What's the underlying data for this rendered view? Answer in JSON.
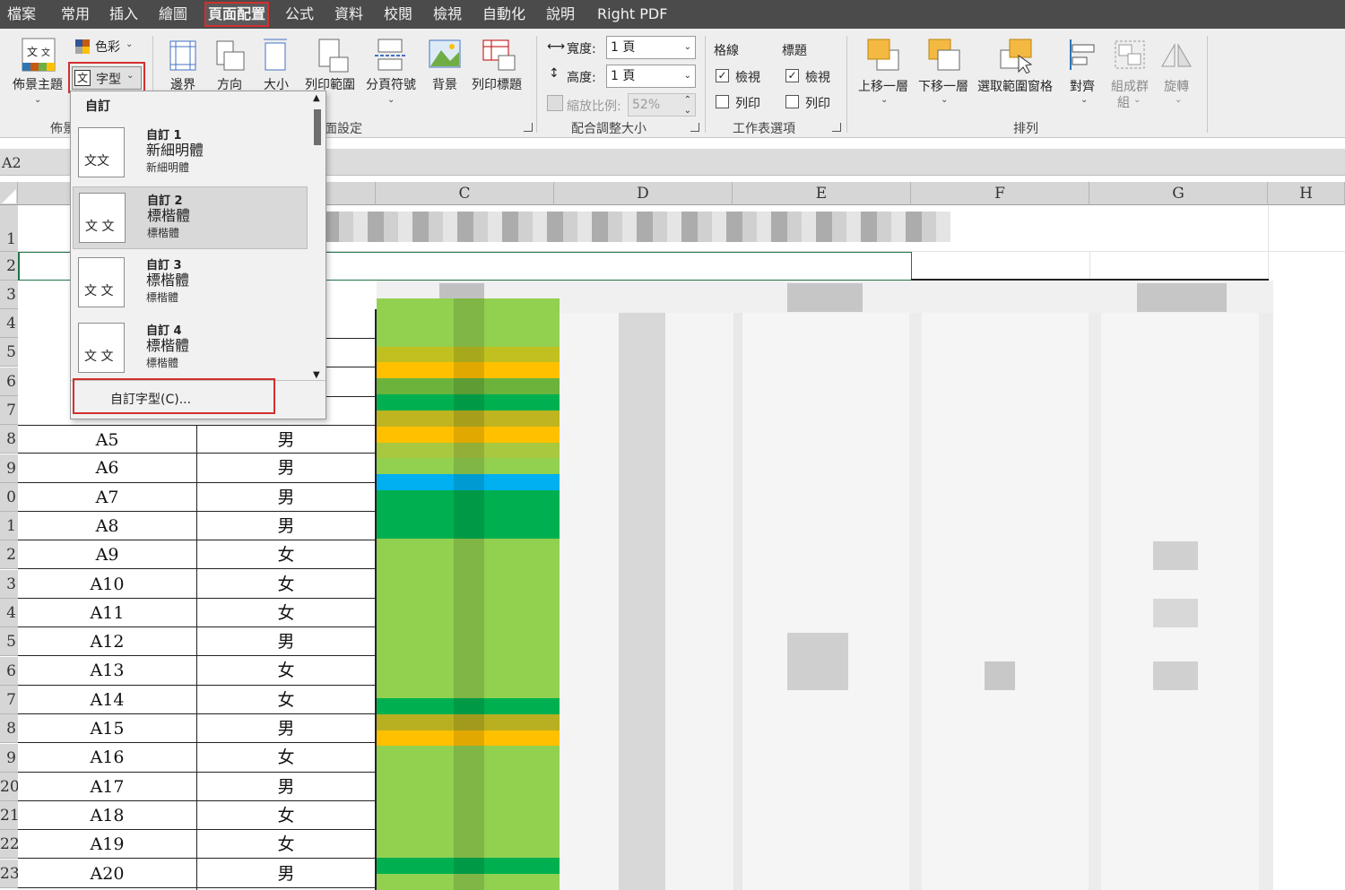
{
  "menu": {
    "items": [
      "檔案",
      "常用",
      "插入",
      "繪圖",
      "頁面配置",
      "公式",
      "資料",
      "校閱",
      "檢視",
      "自動化",
      "說明",
      "Right PDF"
    ],
    "active": "頁面配置"
  },
  "ribbon": {
    "themes": {
      "label": "佈景主題",
      "colors": "色彩",
      "fonts": "字型",
      "group_label": "佈景"
    },
    "page_setup": {
      "margins": "邊界",
      "orientation": "方向",
      "size": "大小",
      "print_area": "列印範圍",
      "breaks": "分頁符號",
      "background": "背景",
      "print_titles": "列印標題",
      "group_label": "面設定"
    },
    "scale": {
      "width_label": "寬度:",
      "width_value": "1 頁",
      "height_label": "高度:",
      "height_value": "1 頁",
      "zoom_label": "縮放比例:",
      "zoom_value": "52%",
      "group_label": "配合調整大小"
    },
    "sheet_options": {
      "gridlines": "格線",
      "headings": "標題",
      "view": "檢視",
      "print": "列印",
      "group_label": "工作表選項"
    },
    "arrange": {
      "bring_forward": "上移一層",
      "send_backward": "下移一層",
      "selection_pane": "選取範圍窗格",
      "align": "對齊",
      "group": "組成群",
      "group2": "組",
      "rotate": "旋轉",
      "group_label": "排列"
    }
  },
  "formula_bar": {
    "name_box": "A2"
  },
  "sheet": {
    "columns": [
      "C",
      "D",
      "E",
      "F",
      "G",
      "H"
    ],
    "row_numbers": [
      "1",
      "2",
      "3",
      "4",
      "5",
      "6",
      "7",
      "8",
      "9",
      "0",
      "1",
      "2",
      "3",
      "4",
      "5",
      "6",
      "7",
      "8",
      "9",
      "20",
      "21",
      "22",
      "23"
    ],
    "rows": [
      {
        "id": "A5",
        "gender": "男"
      },
      {
        "id": "A6",
        "gender": "男"
      },
      {
        "id": "A7",
        "gender": "男"
      },
      {
        "id": "A8",
        "gender": "男"
      },
      {
        "id": "A9",
        "gender": "女"
      },
      {
        "id": "A10",
        "gender": "女"
      },
      {
        "id": "A11",
        "gender": "女"
      },
      {
        "id": "A12",
        "gender": "男"
      },
      {
        "id": "A13",
        "gender": "女"
      },
      {
        "id": "A14",
        "gender": "女"
      },
      {
        "id": "A15",
        "gender": "男"
      },
      {
        "id": "A16",
        "gender": "女"
      },
      {
        "id": "A17",
        "gender": "男"
      },
      {
        "id": "A18",
        "gender": "女"
      },
      {
        "id": "A19",
        "gender": "女"
      },
      {
        "id": "A20",
        "gender": "男"
      }
    ],
    "heat_colors": [
      "#92d050",
      "#92d050",
      "#92d050",
      "#c0c020",
      "#ffc000",
      "#6cb33c",
      "#00b050",
      "#bfb520",
      "#ffc000",
      "#a8c840",
      "#92d050",
      "#00b0f0",
      "#00b050",
      "#00b050",
      "#00b050",
      "#92d050",
      "#92d050",
      "#92d050",
      "#92d050",
      "#92d050",
      "#92d050",
      "#92d050",
      "#92d050",
      "#92d050",
      "#92d050",
      "#00b050",
      "#b8b020",
      "#ffc000",
      "#92d050",
      "#92d050",
      "#92d050",
      "#92d050",
      "#92d050",
      "#92d050",
      "#92d050",
      "#00b050",
      "#92d050"
    ]
  },
  "font_dropdown": {
    "header": "自訂",
    "items": [
      {
        "name": "自訂 1",
        "heading_font": "新細明體",
        "body_font": "新細明體",
        "thumb": "文文"
      },
      {
        "name": "自訂 2",
        "heading_font": "標楷體",
        "body_font": "標楷體",
        "thumb": "文 文"
      },
      {
        "name": "自訂 3",
        "heading_font": "標楷體",
        "body_font": "標楷體",
        "thumb": "文 文"
      },
      {
        "name": "自訂 4",
        "heading_font": "標楷體",
        "body_font": "標楷體",
        "thumb": "文 文"
      }
    ],
    "custom_fonts": "自訂字型(C)..."
  }
}
